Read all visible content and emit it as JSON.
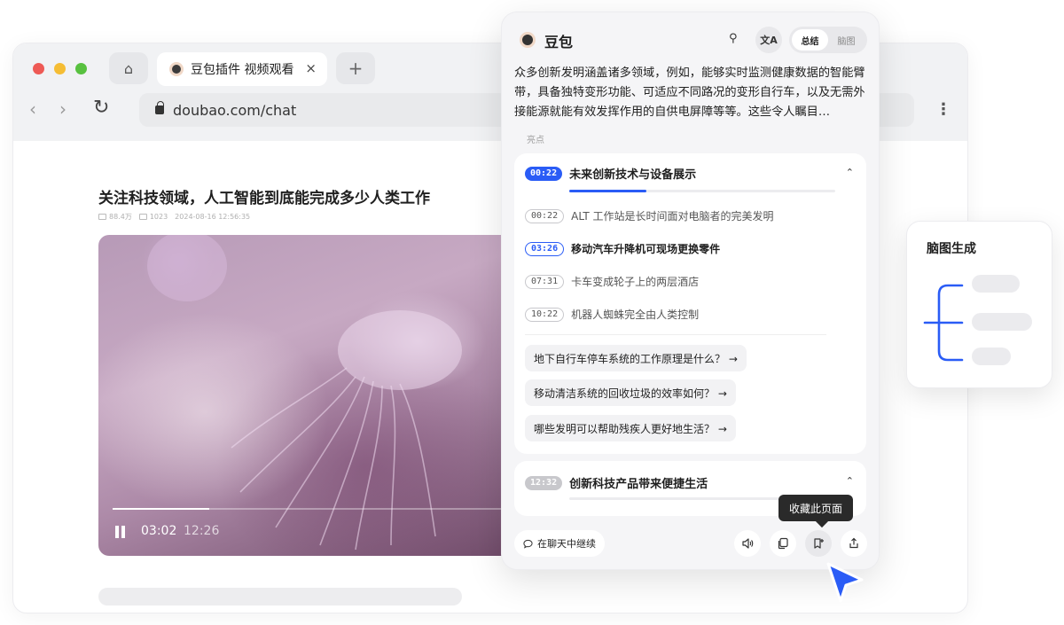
{
  "browser": {
    "tab_title": "豆包插件 视频观看",
    "tab_close": "×",
    "new_tab": "+",
    "url": "doubao.com/chat",
    "kebab": "⋮",
    "nav_back": "‹",
    "nav_forward": "›",
    "reload": "↻",
    "home": "⌂"
  },
  "page": {
    "title": "关注科技领域，人工智能到底能完成多少人类工作",
    "views": "88.4万",
    "comments": "1023",
    "date": "2024-08-16 12:56:35"
  },
  "video": {
    "current_time": "03:02",
    "total_time": "12:26",
    "progress": 0.24
  },
  "panel": {
    "name": "豆包",
    "search_icon": "⚲",
    "translate_label": "文A",
    "tabs": [
      {
        "label": "总结",
        "active": true
      },
      {
        "label": "脑图",
        "active": false
      }
    ],
    "summary": "众多创新发明涵盖诸多领域，例如，能够实时监测健康数据的智能臂带，具备独特变形功能、可适应不同路况的变形自行车，以及无需外接能源就能有效发挥作用的自供电屏障等等。这些令人瞩目…",
    "highlights_label": "亮点",
    "section1": {
      "time": "00:22",
      "title": "未来创新技术与设备展示",
      "progress": 0.29,
      "items": [
        {
          "time": "00:22",
          "text": "ALT 工作站是长时间面对电脑者的完美发明"
        },
        {
          "time": "03:26",
          "text": "移动汽车升降机可现场更换零件"
        },
        {
          "time": "07:31",
          "text": "卡车变成轮子上的两层酒店"
        },
        {
          "time": "10:22",
          "text": "机器人蜘蛛完全由人类控制"
        }
      ],
      "questions": [
        "地下自行车停车系统的工作原理是什么？ →",
        "移动清洁系统的回收垃圾的效率如何？ →",
        "哪些发明可以帮助残疾人更好地生活？ →"
      ]
    },
    "section2": {
      "time": "12:32",
      "title": "创新科技产品带来便捷生活"
    },
    "chevron": "⌃",
    "continue_label": "在聊天中继续",
    "tooltip": "收藏此页面"
  },
  "mindmap": {
    "title": "脑图生成"
  },
  "colors": {
    "accent": "#2a5cf6",
    "cursor": "#2a5cf6"
  }
}
